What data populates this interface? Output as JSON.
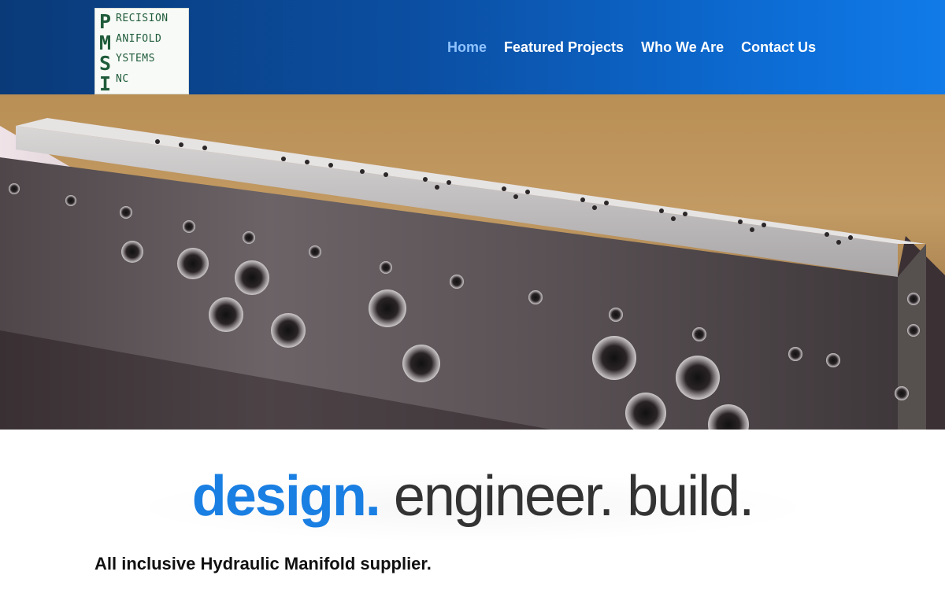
{
  "header": {
    "logo": {
      "letters": [
        "P",
        "M",
        "S",
        "I"
      ],
      "words": [
        "RECISION",
        "ANIFOLD",
        "YSTEMS",
        "NC"
      ]
    },
    "nav": [
      {
        "label": "Home",
        "active": true
      },
      {
        "label": "Featured Projects",
        "active": false
      },
      {
        "label": "Who We Are",
        "active": false
      },
      {
        "label": "Contact Us",
        "active": false
      }
    ]
  },
  "hero": {
    "image": "machined hydraulic manifold block"
  },
  "tagline": {
    "word1": "design.",
    "word2": "engineer. build."
  },
  "subhead": "All inclusive Hydraulic Manifold supplier.",
  "colors": {
    "header_start": "#0a3a78",
    "header_end": "#117be8",
    "nav_active": "#8fc3ff",
    "accent": "#1a7fe3",
    "logo_green": "#1f5b3a"
  }
}
